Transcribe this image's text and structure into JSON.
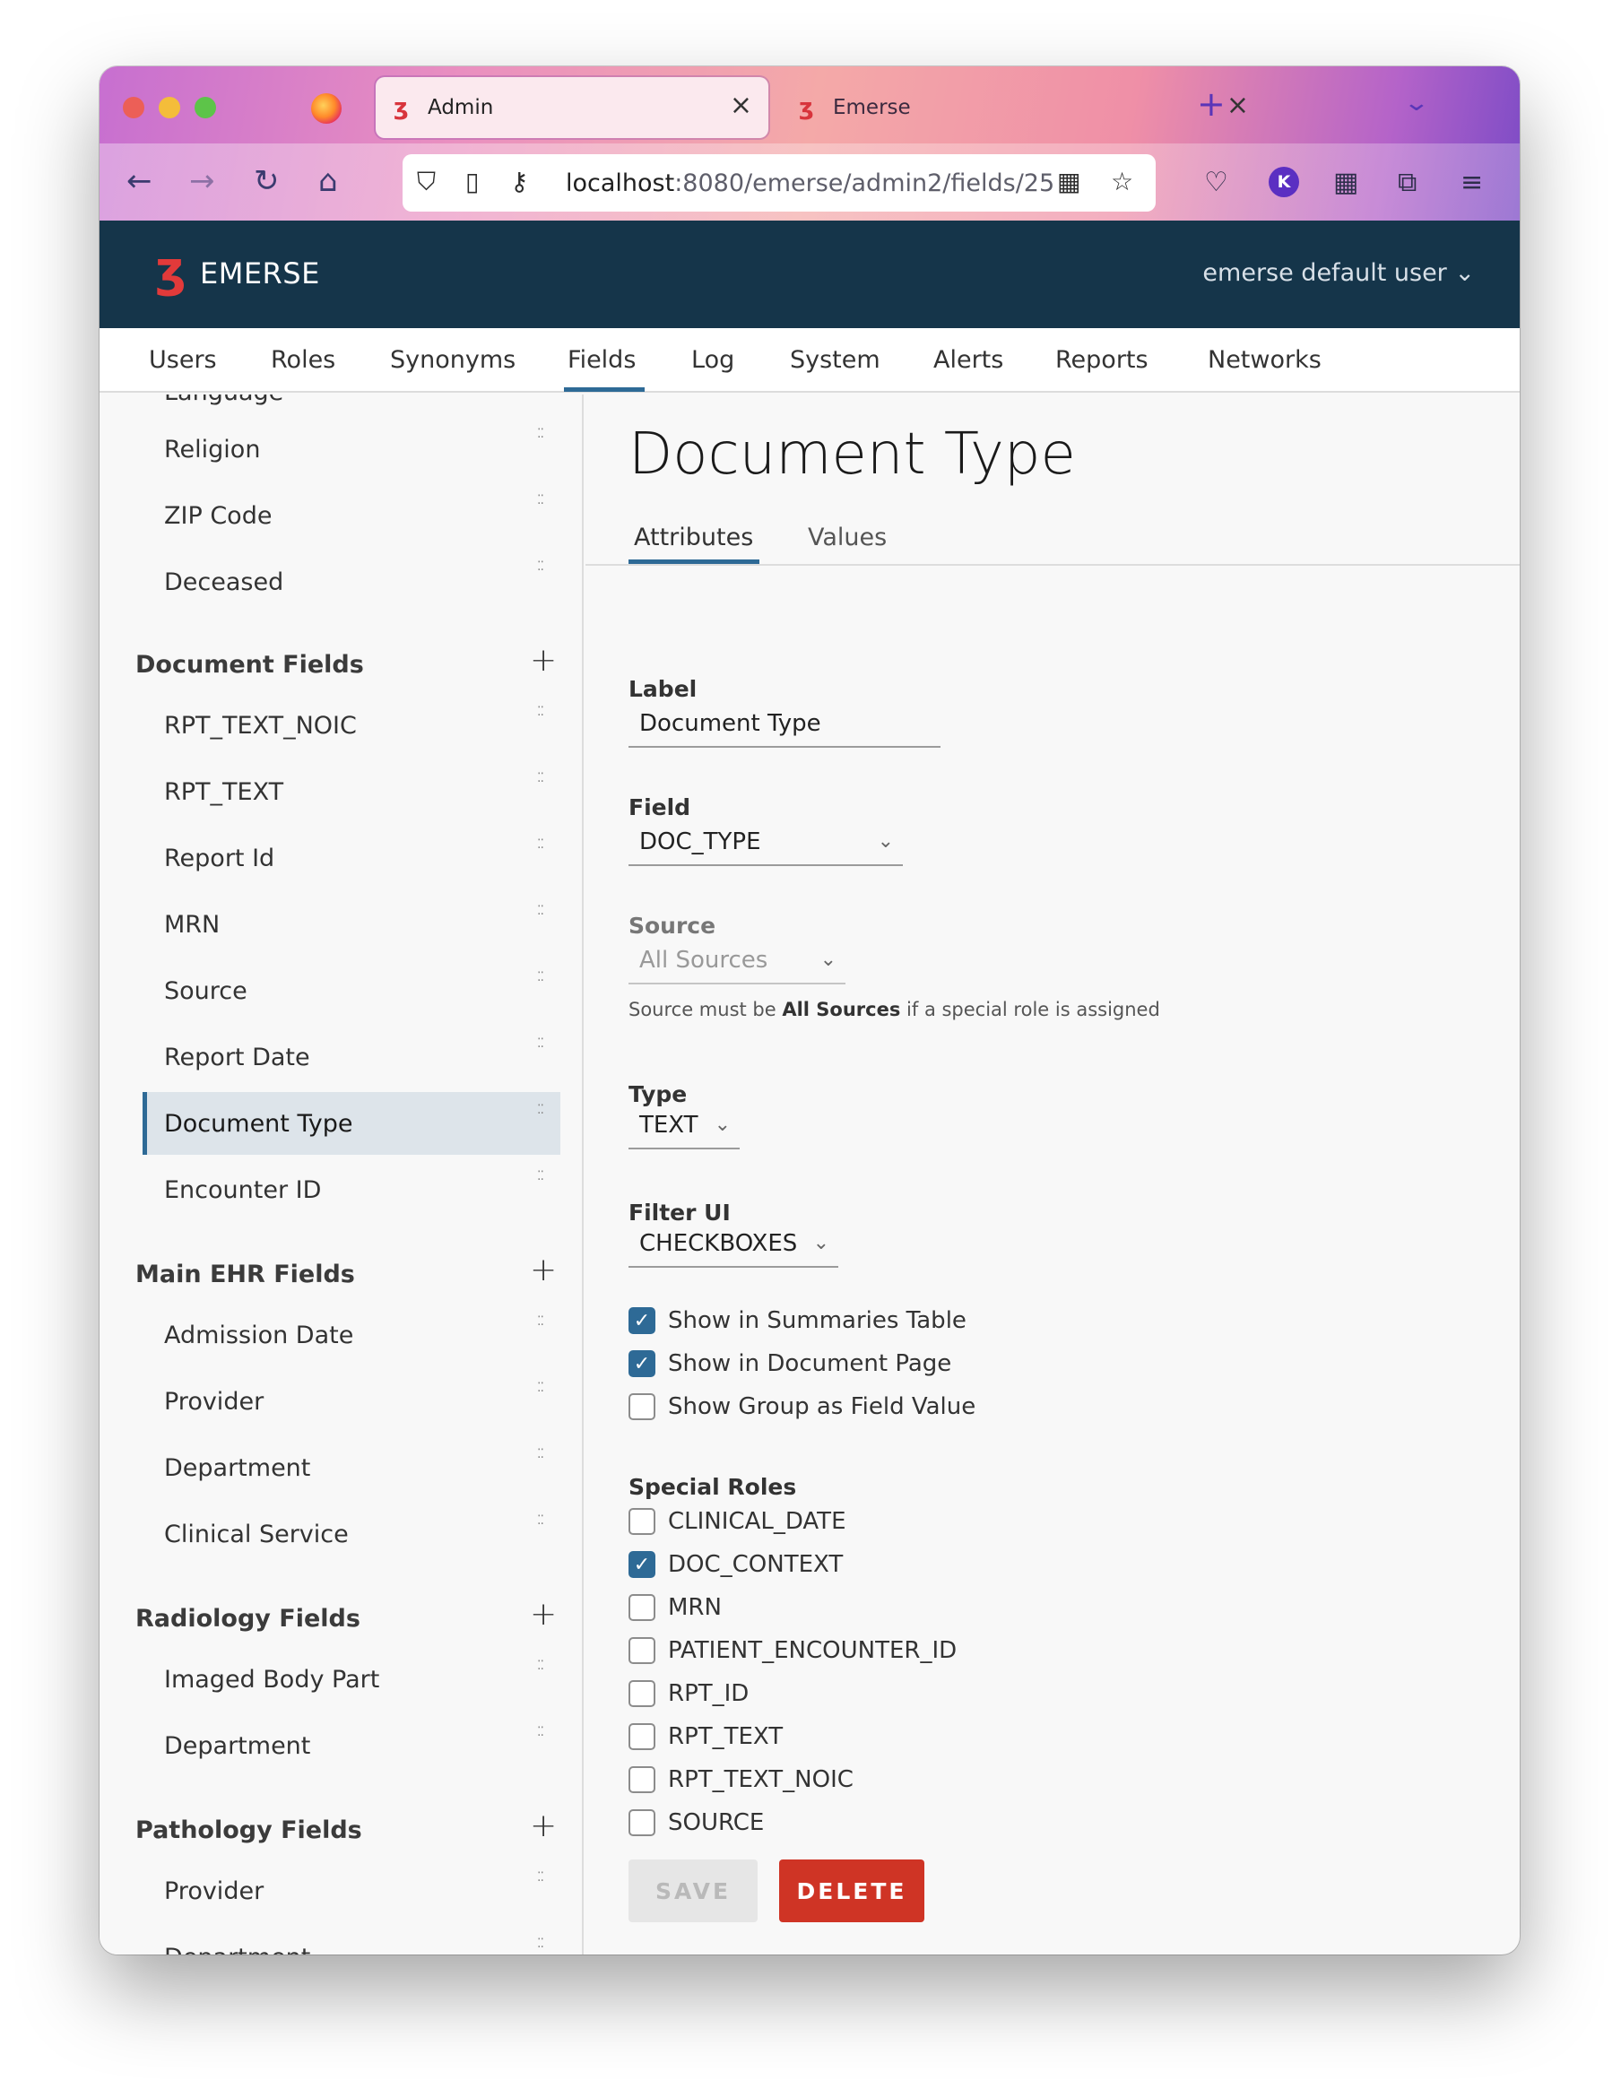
{
  "browser": {
    "tabs": [
      {
        "label": "Admin",
        "active": true
      },
      {
        "label": "Emerse",
        "active": false
      }
    ],
    "url_host": "localhost",
    "url_path": ":8080/emerse/admin2/fields/25"
  },
  "header": {
    "logo_text": "EMERSE",
    "user_menu": "emerse default user ⌄"
  },
  "nav": {
    "items": [
      "Users",
      "Roles",
      "Synonyms",
      "Fields",
      "Log",
      "System",
      "Alerts",
      "Reports",
      "Networks"
    ],
    "active": "Fields"
  },
  "sidebar": {
    "partial_top": "Language",
    "demographic_items": [
      "Religion",
      "ZIP Code",
      "Deceased"
    ],
    "sections": [
      {
        "title": "Document Fields",
        "items": [
          "RPT_TEXT_NOIC",
          "RPT_TEXT",
          "Report Id",
          "MRN",
          "Source",
          "Report Date",
          "Document Type",
          "Encounter ID"
        ]
      },
      {
        "title": "Main EHR Fields",
        "items": [
          "Admission Date",
          "Provider",
          "Department",
          "Clinical Service"
        ]
      },
      {
        "title": "Radiology Fields",
        "items": [
          "Imaged Body Part",
          "Department"
        ]
      },
      {
        "title": "Pathology Fields",
        "items": [
          "Provider",
          "Department"
        ]
      }
    ],
    "selected": "Document Type"
  },
  "content": {
    "title": "Document Type",
    "tabs": [
      "Attributes",
      "Values"
    ],
    "active_tab": "Attributes",
    "label_label": "Label",
    "label_value": "Document Type",
    "field_label": "Field",
    "field_value": "DOC_TYPE",
    "source_label": "Source",
    "source_value": "All Sources",
    "source_help_pre": "Source must be ",
    "source_help_bold": "All Sources",
    "source_help_post": " if a special role is assigned",
    "type_label": "Type",
    "type_value": "TEXT",
    "filter_label": "Filter UI",
    "filter_value": "CHECKBOXES",
    "display_options": [
      {
        "label": "Show in Summaries Table",
        "checked": true
      },
      {
        "label": "Show in Document Page",
        "checked": true
      },
      {
        "label": "Show Group as Field Value",
        "checked": false
      }
    ],
    "special_roles_label": "Special Roles",
    "special_roles": [
      {
        "label": "CLINICAL_DATE",
        "checked": false
      },
      {
        "label": "DOC_CONTEXT",
        "checked": true
      },
      {
        "label": "MRN",
        "checked": false
      },
      {
        "label": "PATIENT_ENCOUNTER_ID",
        "checked": false
      },
      {
        "label": "RPT_ID",
        "checked": false
      },
      {
        "label": "RPT_TEXT",
        "checked": false
      },
      {
        "label": "RPT_TEXT_NOIC",
        "checked": false
      },
      {
        "label": "SOURCE",
        "checked": false
      }
    ],
    "save_label": "SAVE",
    "delete_label": "DELETE"
  },
  "colors": {
    "header_bg": "#15354a",
    "accent": "#2e6a96",
    "delete": "#cf3425"
  }
}
